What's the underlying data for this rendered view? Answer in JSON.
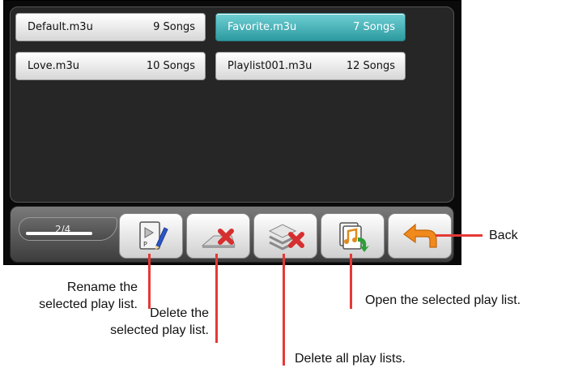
{
  "playlists": [
    {
      "name": "Default.m3u",
      "count": "9 Songs",
      "selected": false
    },
    {
      "name": "Favorite.m3u",
      "count": "7 Songs",
      "selected": true
    },
    {
      "name": "Love.m3u",
      "count": "10 Songs",
      "selected": false
    },
    {
      "name": "Playlist001.m3u",
      "count": "12 Songs",
      "selected": false
    }
  ],
  "toolbar": {
    "page_indicator": "2/4",
    "buttons": [
      {
        "name": "rename-button",
        "icon": "rename-icon"
      },
      {
        "name": "delete-button",
        "icon": "delete-icon"
      },
      {
        "name": "delete-all-button",
        "icon": "delete-all-icon"
      },
      {
        "name": "open-button",
        "icon": "open-playlist-icon"
      },
      {
        "name": "back-button",
        "icon": "back-arrow-icon"
      }
    ]
  },
  "annotations": {
    "back": "Back",
    "rename_line1": "Rename the",
    "rename_line2": "selected play list.",
    "delete_line1": "Delete the",
    "delete_line2": "selected play list.",
    "delete_all": "Delete all play lists.",
    "open": "Open the selected play list."
  },
  "colors": {
    "selected_item": "#3fb3b8",
    "callout_line": "#e53935",
    "delete_x": "#d62f2f",
    "open_arrow": "#2e9e3a",
    "back_arrow": "#f08a1c"
  }
}
